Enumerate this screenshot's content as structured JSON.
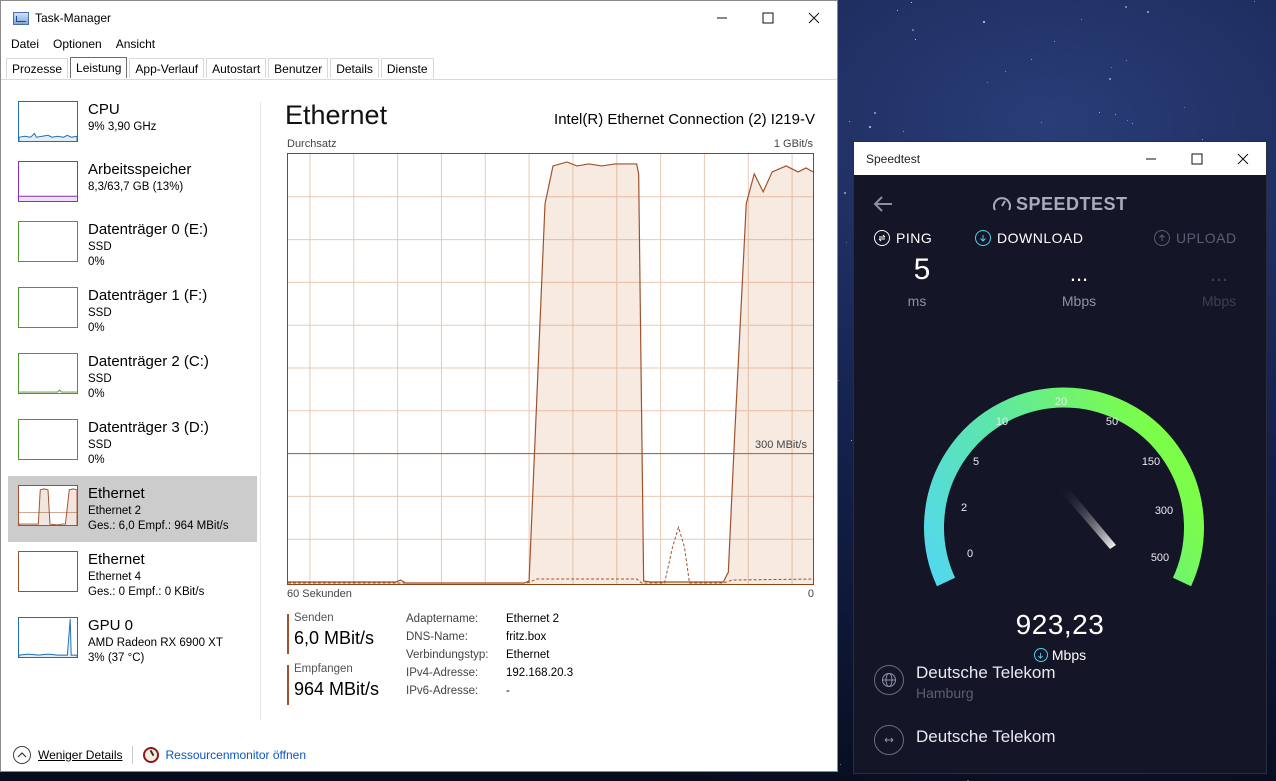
{
  "taskmanager": {
    "title": "Task-Manager",
    "menu": [
      "Datei",
      "Optionen",
      "Ansicht"
    ],
    "tabs": [
      "Prozesse",
      "Leistung",
      "App-Verlauf",
      "Autostart",
      "Benutzer",
      "Details",
      "Dienste"
    ],
    "active_tab": "Leistung",
    "sidebar": [
      {
        "name": "CPU",
        "line1": "9%  3,90 GHz",
        "line2": "",
        "color": "#1f6fb2"
      },
      {
        "name": "Arbeitsspeicher",
        "line1": "8,3/63,7 GB (13%)",
        "line2": "",
        "color": "#8b2fb5"
      },
      {
        "name": "Datenträger 0 (E:)",
        "line1": "SSD",
        "line2": "0%",
        "color": "#4d9a2a"
      },
      {
        "name": "Datenträger 1 (F:)",
        "line1": "SSD",
        "line2": "0%",
        "color": "#4d9a2a"
      },
      {
        "name": "Datenträger 2 (C:)",
        "line1": "SSD",
        "line2": "0%",
        "color": "#4d9a2a"
      },
      {
        "name": "Datenträger 3 (D:)",
        "line1": "SSD",
        "line2": "0%",
        "color": "#4d9a2a"
      },
      {
        "name": "Ethernet",
        "line1": "Ethernet 2",
        "line2": "Ges.: 6,0  Empf.: 964 MBit/s",
        "color": "#a0522d"
      },
      {
        "name": "Ethernet",
        "line1": "Ethernet 4",
        "line2": "Ges.: 0  Empf.: 0 KBit/s",
        "color": "#a0522d"
      },
      {
        "name": "GPU 0",
        "line1": "AMD Radeon RX 6900 XT",
        "line2": "3%  (37 °C)",
        "color": "#1f6fb2"
      }
    ],
    "main": {
      "title": "Ethernet",
      "adapter": "Intel(R) Ethernet Connection (2) I219-V",
      "graph_label": "Durchsatz",
      "graph_max": "1 GBit/s",
      "graph_scale": "300 MBit/s",
      "graph_left": "60 Sekunden",
      "graph_right": "0",
      "send_label": "Senden",
      "send_value": "6,0 MBit/s",
      "recv_label": "Empfangen",
      "recv_value": "964 MBit/s",
      "props": [
        {
          "k": "Adaptername:",
          "v": "Ethernet 2"
        },
        {
          "k": "DNS-Name:",
          "v": "fritz.box"
        },
        {
          "k": "Verbindungstyp:",
          "v": "Ethernet"
        },
        {
          "k": "IPv4-Adresse:",
          "v": "192.168.20.3"
        },
        {
          "k": "IPv6-Adresse:",
          "v": "-"
        }
      ]
    },
    "footer": {
      "fewer_details": "Weniger Details",
      "resource_monitor": "Ressourcenmonitor öffnen"
    }
  },
  "speedtest": {
    "title": "Speedtest",
    "logo": "SPEEDTEST",
    "ping_label": "PING",
    "ping_value": "5",
    "ping_unit": "ms",
    "download_label": "DOWNLOAD",
    "download_value": "...",
    "download_unit": "Mbps",
    "upload_label": "UPLOAD",
    "upload_value": "...",
    "upload_unit": "Mbps",
    "gauge_ticks": [
      "0",
      "2",
      "5",
      "10",
      "20",
      "50",
      "150",
      "300",
      "500"
    ],
    "gauge_value": "923,23",
    "gauge_unit": "Mbps",
    "isp_name": "Deutsche Telekom",
    "isp_location": "Hamburg",
    "server_name": "Deutsche Telekom"
  }
}
